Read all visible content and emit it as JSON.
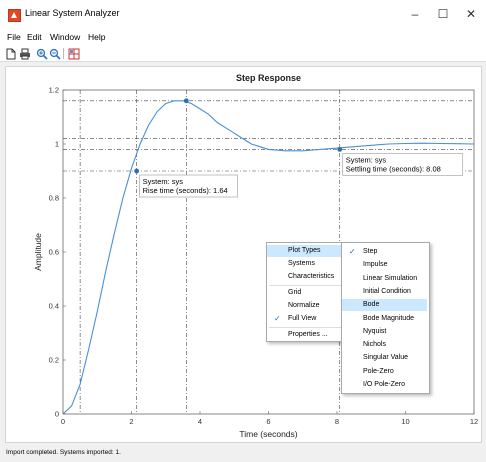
{
  "window": {
    "title": "Linear System Analyzer",
    "minimize": "–",
    "maximize": "☐",
    "close": "✕"
  },
  "menubar": [
    "File",
    "Edit",
    "Window",
    "Help"
  ],
  "toolbar": [
    "new-icon",
    "print-icon",
    "zoom-in-icon",
    "zoom-out-icon",
    "grid-layout-icon"
  ],
  "chart_data": {
    "type": "line",
    "title": "Step Response",
    "xlabel": "Time (seconds)",
    "ylabel": "Amplitude",
    "xlim": [
      0,
      12
    ],
    "ylim": [
      0,
      1.2
    ],
    "xticks": [
      0,
      2,
      4,
      6,
      8,
      10,
      12
    ],
    "yticks": [
      0,
      0.2,
      0.4,
      0.6,
      0.8,
      1,
      1.2
    ],
    "series": [
      {
        "color": "#4a90d9",
        "x": [
          0,
          0.25,
          0.5,
          0.75,
          1,
          1.25,
          1.5,
          1.75,
          2,
          2.25,
          2.5,
          2.75,
          3,
          3.25,
          3.5,
          3.75,
          4,
          4.25,
          4.5,
          4.75,
          5,
          5.25,
          5.5,
          5.75,
          6,
          6.5,
          7,
          7.5,
          8,
          8.5,
          9,
          9.5,
          10,
          10.5,
          11,
          11.5,
          12
        ],
        "y": [
          0,
          0.03,
          0.11,
          0.24,
          0.38,
          0.53,
          0.67,
          0.8,
          0.91,
          1.0,
          1.07,
          1.12,
          1.15,
          1.16,
          1.16,
          1.15,
          1.13,
          1.11,
          1.08,
          1.06,
          1.04,
          1.02,
          1.0,
          0.99,
          0.98,
          0.975,
          0.975,
          0.98,
          0.985,
          0.99,
          0.995,
          1.0,
          1.002,
          1.003,
          1.002,
          1.001,
          1.0
        ]
      }
    ],
    "markers": [
      {
        "x": 2.15,
        "y": 0.9,
        "label1": "System: sys",
        "label2": "Rise time (seconds): 1.64"
      },
      {
        "x": 3.6,
        "y": 1.16
      },
      {
        "x": 8.08,
        "y": 0.98,
        "label1": "System: sys",
        "label2": "Settling time (seconds): 8.08"
      }
    ],
    "ref_lines_y": [
      1.16,
      1.02,
      0.98,
      0.9
    ],
    "ref_lines_x": [
      0.5,
      2.15,
      3.6,
      8.08
    ]
  },
  "context_menu": {
    "items": [
      "Plot Types",
      "Systems",
      "Characteristics",
      "Grid",
      "Normalize",
      "Full View",
      "Properties ..."
    ],
    "checked": "Full View",
    "highlighted": "Plot Types"
  },
  "submenu": {
    "items": [
      "Step",
      "Impulse",
      "Linear Simulation",
      "Initial Condition",
      "Bode",
      "Bode Magnitude",
      "Nyquist",
      "Nichols",
      "Singular Value",
      "Pole-Zero",
      "I/O Pole-Zero"
    ],
    "checked": "Step",
    "highlighted": "Bode"
  },
  "status": "Import completed. Systems imported: 1."
}
